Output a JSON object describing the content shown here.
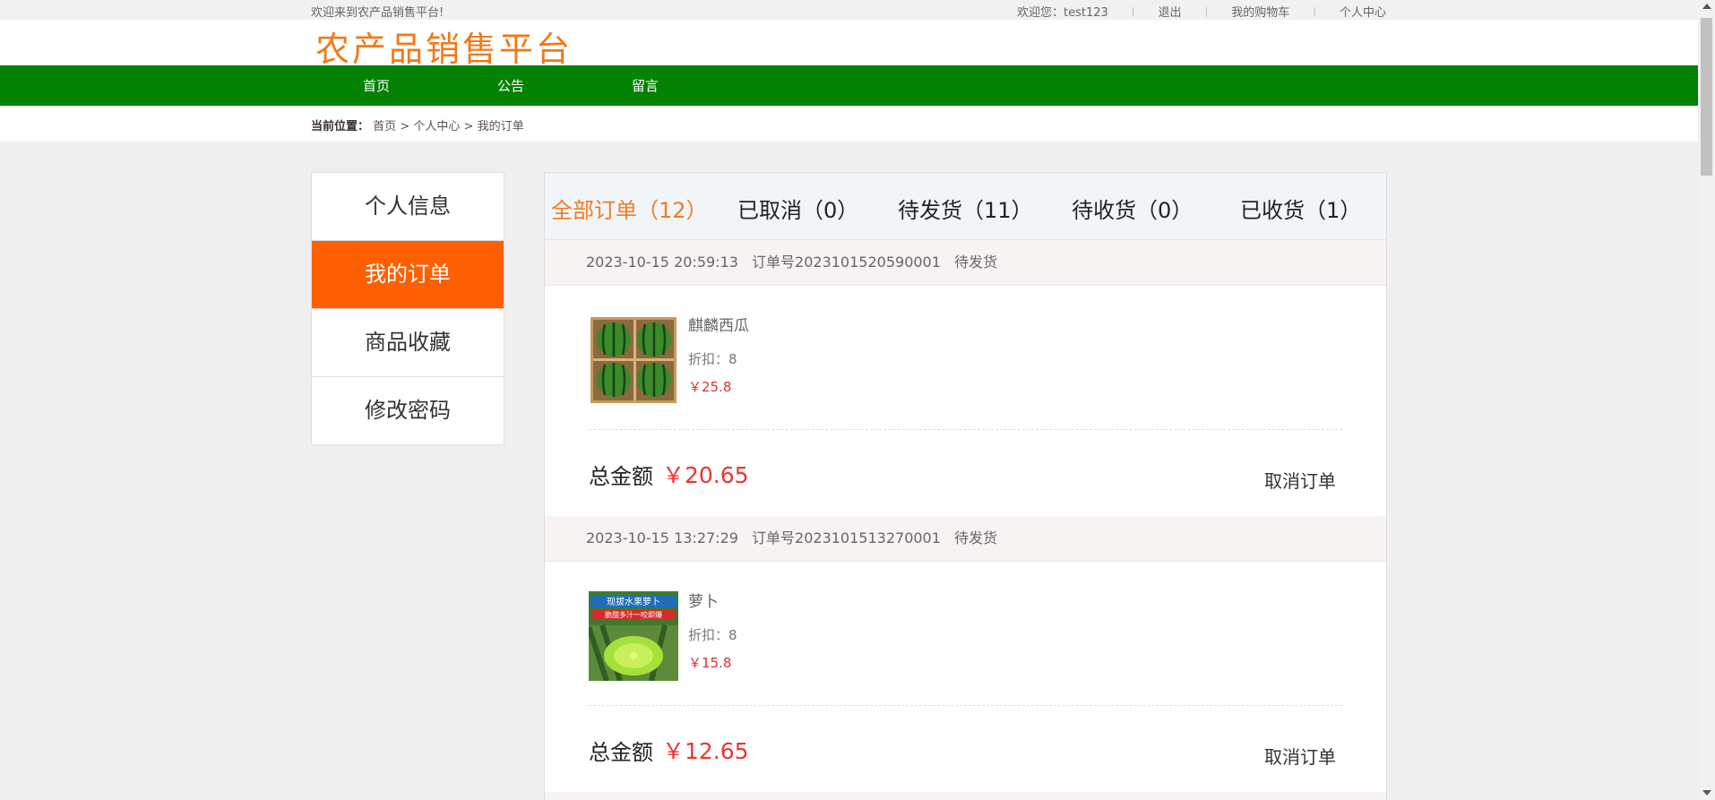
{
  "topbar": {
    "welcome": "欢迎来到农产品销售平台!",
    "user_greeting": "欢迎您：test123",
    "logout": "退出",
    "cart": "我的购物车",
    "profile": "个人中心"
  },
  "header": {
    "logo_text": "农产品销售平台"
  },
  "nav": {
    "items": [
      "首页",
      "公告",
      "留言"
    ]
  },
  "breadcrumb": {
    "label": "当前位置：",
    "home": "首页",
    "sep1": " >",
    "center": "个人中心",
    "sep2": " >",
    "current": "我的订单"
  },
  "sidebar": {
    "items": [
      {
        "label": "个人信息",
        "active": false
      },
      {
        "label": "我的订单",
        "active": true
      },
      {
        "label": "商品收藏",
        "active": false
      },
      {
        "label": "修改密码",
        "active": false
      }
    ]
  },
  "tabs": [
    {
      "label": "全部订单（12）",
      "active": true
    },
    {
      "label": "已取消（0）",
      "active": false
    },
    {
      "label": "待发货（11）",
      "active": false
    },
    {
      "label": "待收货（0）",
      "active": false
    },
    {
      "label": "已收货（1）",
      "active": false
    }
  ],
  "orders": [
    {
      "time": "2023-10-15 20:59:13",
      "order_no": "订单号2023101520590001",
      "status": "待发货",
      "product_name": "麒麟西瓜",
      "discount": "折扣：8",
      "price": "￥25.8",
      "total_label": "总金额",
      "total_value": "￥20.65",
      "action": "取消订单"
    },
    {
      "time": "2023-10-15 13:27:29",
      "order_no": "订单号2023101513270001",
      "status": "待发货",
      "product_name": "萝卜",
      "discount": "折扣：8",
      "price": "￥15.8",
      "total_label": "总金额",
      "total_value": "￥12.65",
      "action": "取消订单",
      "image_caption_line1": "现拔水果萝卜",
      "image_caption_line2": "脆甜多汁一咬即爆"
    }
  ],
  "colors": {
    "nav_green": "#038203",
    "accent_orange": "#fe5f00",
    "tab_active": "#f47a20",
    "price_red": "#e03131"
  }
}
